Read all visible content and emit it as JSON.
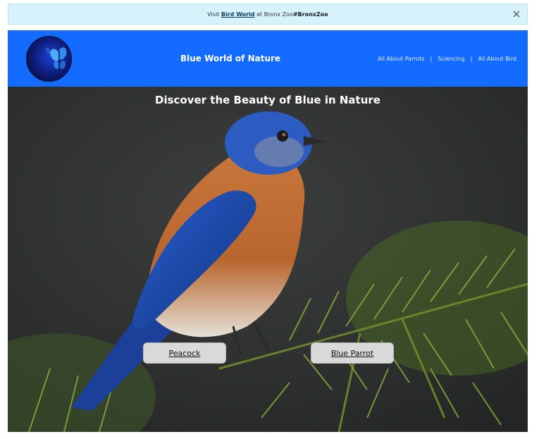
{
  "announcement": {
    "prefix": "Visit ",
    "link": "Bird World",
    "middle": " at Bronx Zoo",
    "tag": "#BronxZoo"
  },
  "header": {
    "title": "Blue World of Nature",
    "nav": [
      "All About Parrots",
      "Sciencing",
      "All About Bird"
    ],
    "separator": "|"
  },
  "hero": {
    "title": "Discover the Beauty of Blue in Nature",
    "buttons": [
      "Peacock",
      "Blue Parrot"
    ]
  },
  "icons": {
    "close": "close-icon",
    "logo": "butterfly-logo"
  },
  "colors": {
    "announcement_bg": "#d6f3fb",
    "header_bg": "#136cff",
    "button_bg": "#d9d9d9"
  }
}
